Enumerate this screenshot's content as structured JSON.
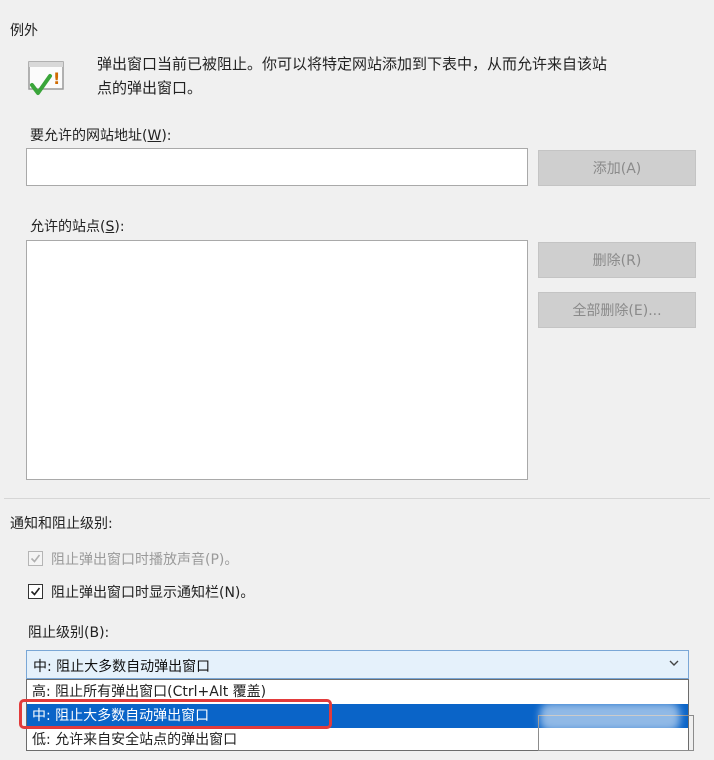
{
  "exceptions": {
    "legend": "例外",
    "info_line1": "弹出窗口当前已被阻止。你可以将特定网站添加到下表中，从而允许来自该站",
    "info_line2": "点的弹出窗口。",
    "address_label_text": "要允许的网站地址(",
    "address_label_key": "W",
    "address_label_end": "):",
    "address_value": "",
    "add_button": "添加(A)",
    "allowed_label_text": "允许的站点(",
    "allowed_label_key": "S",
    "allowed_label_end": "):",
    "allowed_sites": [],
    "remove_button": "删除(R)",
    "remove_all_button": "全部删除(E)..."
  },
  "notifications": {
    "section_label": "通知和阻止级别:",
    "play_sound": {
      "label": "阻止弹出窗口时播放声音(P)。",
      "checked": true,
      "disabled": true
    },
    "show_bar": {
      "label": "阻止弹出窗口时显示通知栏(N)。",
      "checked": true,
      "disabled": false
    },
    "level_label": "阻止级别(B):",
    "level_selected": "中: 阻止大多数自动弹出窗口",
    "level_options": [
      "高: 阻止所有弹出窗口(Ctrl+Alt 覆盖)",
      "中: 阻止大多数自动弹出窗口",
      "低: 允许来自安全站点的弹出窗口"
    ],
    "highlighted_option_index": 1
  },
  "colors": {
    "highlight": "#0a64c8",
    "callout": "#e23b3b",
    "disabled_button": "#cfcfcf"
  }
}
